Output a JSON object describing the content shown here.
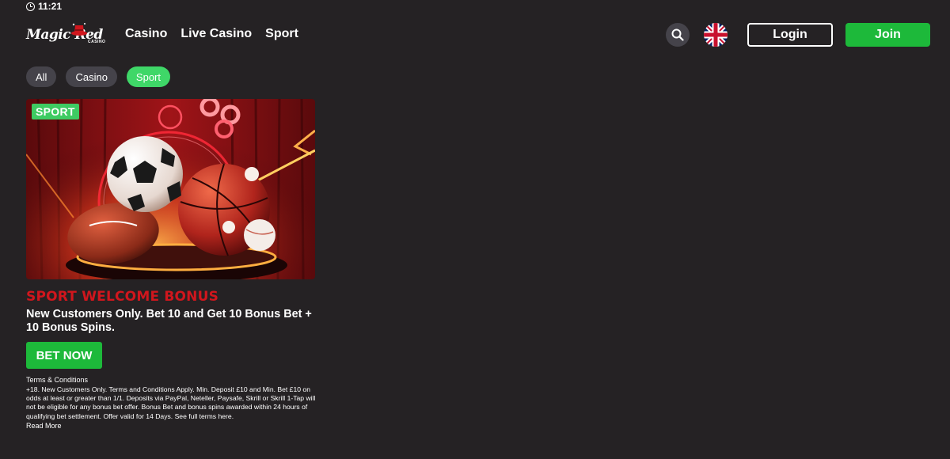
{
  "status_bar": {
    "time": "11:21",
    "clock_icon": "clock-icon"
  },
  "header": {
    "logo": {
      "brand": "Magic Red",
      "sub": "CASINO"
    },
    "nav": [
      "Casino",
      "Live Casino",
      "Sport"
    ],
    "search_icon": "search-icon",
    "language_flag": "uk-flag-icon",
    "login_label": "Login",
    "join_label": "Join"
  },
  "filters": [
    {
      "label": "All",
      "active": false
    },
    {
      "label": "Casino",
      "active": false
    },
    {
      "label": "Sport",
      "active": true
    }
  ],
  "promo": {
    "tag": "SPORT",
    "title": "SPORT WELCOME BONUS",
    "description": "New Customers Only. Bet 10 and Get 10 Bonus Bet + 10 Bonus Spins.",
    "cta_label": "BET NOW",
    "terms_heading": "Terms & Conditions",
    "terms_text": "+18. New Customers Only. Terms and Conditions Apply. Min. Deposit £10 and Min. Bet £10 on odds at least or greater than 1/1. Deposits via PayPal, Neteller, Paysafe, Skrill or Skrill 1-Tap will not be eligible for any bonus bet offer. Bonus Bet and bonus spins awarded within 24 hours of qualifying bet settlement. Offer valid for 14 Days. See full terms here.",
    "read_more": "Read More"
  },
  "colors": {
    "background": "#252224",
    "accent_green": "#1db93a",
    "chip_active": "#3fd768",
    "chip": "#45434a",
    "promo_title_red": "#d0161d"
  }
}
